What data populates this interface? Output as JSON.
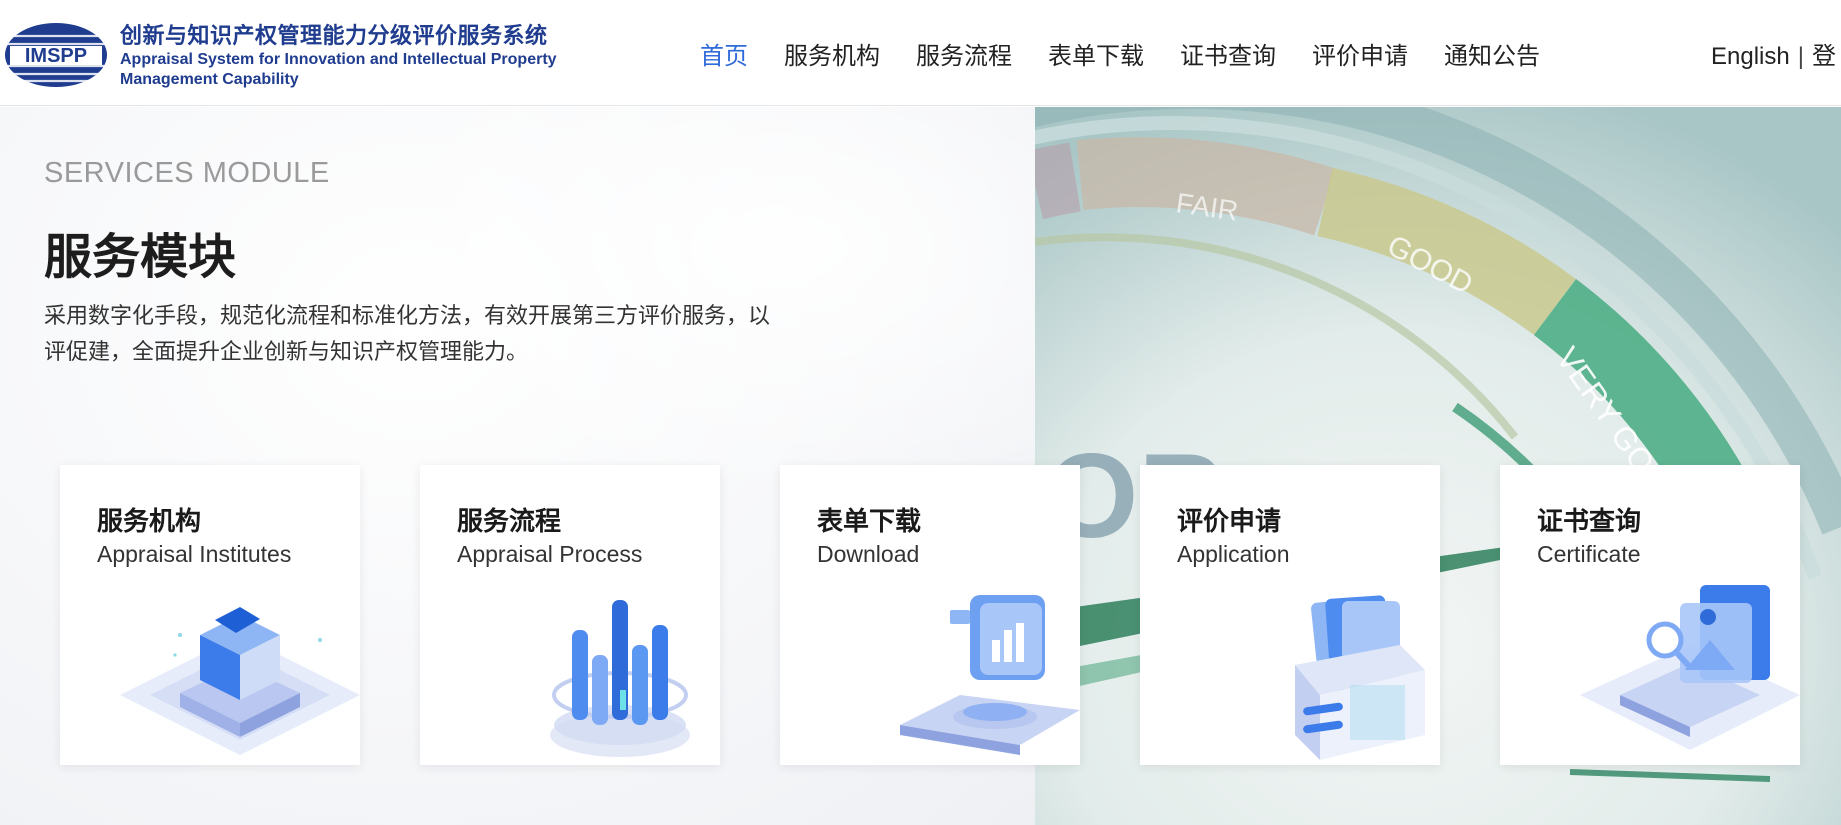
{
  "header": {
    "logo_text": "IMSPP",
    "brand_cn": "创新与知识产权管理能力分级评价服务系统",
    "brand_en": "Appraisal System for Innovation and Intellectual Property Management Capability",
    "nav": [
      {
        "label": "首页",
        "active": true
      },
      {
        "label": "服务机构",
        "active": false
      },
      {
        "label": "服务流程",
        "active": false
      },
      {
        "label": "表单下载",
        "active": false
      },
      {
        "label": "证书查询",
        "active": false
      },
      {
        "label": "评价申请",
        "active": false
      },
      {
        "label": "通知公告",
        "active": false
      }
    ],
    "lang": "English",
    "login": "登"
  },
  "hero": {
    "eyebrow": "SERVICES MODULE",
    "title": "服务模块",
    "description": "采用数字化手段，规范化流程和标准化方法，有效开展第三方评价服务，以评促建，全面提升企业创新与知识产权管理能力。",
    "gauge_labels": [
      "FAIR",
      "GOOD",
      "VERY GOOD"
    ],
    "gauge_letters": "OR"
  },
  "cards": [
    {
      "cn": "服务机构",
      "en": "Appraisal Institutes",
      "icon": "cube-icon"
    },
    {
      "cn": "服务流程",
      "en": "Appraisal Process",
      "icon": "bar-cylinder-icon"
    },
    {
      "cn": "表单下载",
      "en": "Download",
      "icon": "chart-document-icon"
    },
    {
      "cn": "评价申请",
      "en": "Application",
      "icon": "file-box-icon"
    },
    {
      "cn": "证书查询",
      "en": "Certificate",
      "icon": "search-certificate-icon"
    }
  ],
  "colors": {
    "brand": "#1f3c8f",
    "accent": "#2f6bd9",
    "illustration": "#3b7bea"
  }
}
